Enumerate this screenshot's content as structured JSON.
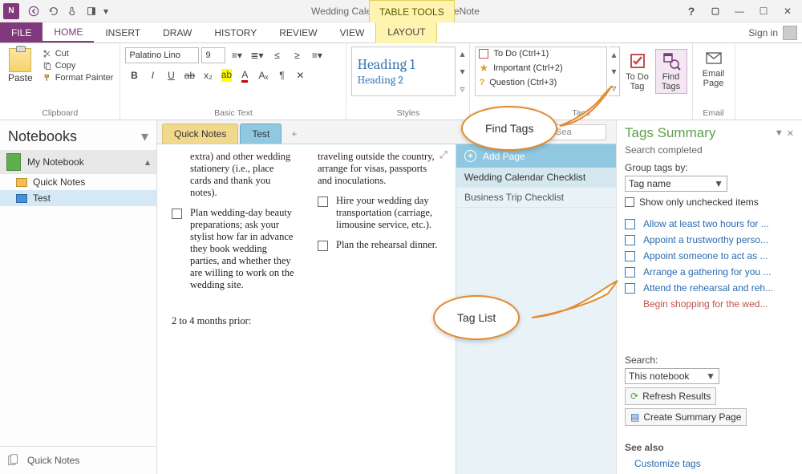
{
  "app": {
    "title": "Wedding Calendar Checklist - OneNote",
    "tabletools": "TABLE TOOLS",
    "signin": "Sign in"
  },
  "ribbon": {
    "file": "FILE",
    "tabs": [
      "HOME",
      "INSERT",
      "DRAW",
      "HISTORY",
      "REVIEW",
      "VIEW",
      "LAYOUT"
    ],
    "active_tab": "HOME",
    "clipboard": {
      "paste": "Paste",
      "cut": "Cut",
      "copy": "Copy",
      "painter": "Format Painter",
      "label": "Clipboard"
    },
    "basic_text": {
      "font": "Palatino Lino",
      "size": "9",
      "label": "Basic Text"
    },
    "styles": {
      "h1": "Heading 1",
      "h2": "Heading 2",
      "label": "Styles"
    },
    "tags": {
      "items": [
        {
          "label": "To Do (Ctrl+1)"
        },
        {
          "label": "Important (Ctrl+2)"
        },
        {
          "label": "Question (Ctrl+3)"
        }
      ],
      "todo": "To Do Tag",
      "find": "Find Tags",
      "label": "Tags"
    },
    "email": {
      "btn": "Email Page",
      "label": "Email"
    }
  },
  "notebooks": {
    "heading": "Notebooks",
    "current": "My Notebook",
    "sections": [
      "Quick Notes",
      "Test"
    ],
    "selected_section": "Test",
    "footer": "Quick Notes"
  },
  "section_tabs": {
    "tabs": [
      "Quick Notes",
      "Test"
    ],
    "active": "Test",
    "search_placeholder": "Sea"
  },
  "page": {
    "col1": [
      "extra) and other wedding stationery (i.e., place cards and thank you notes).",
      "Plan wedding-day beauty preparations; ask your stylist how far in advance they book wedding parties, and whether they are willing to work on the wedding site."
    ],
    "col2": [
      "traveling outside the country, arrange for visas, passports and inoculations.",
      "Hire your wedding day transportation (carriage, limousine service, etc.).",
      "Plan the rehearsal dinner."
    ],
    "section_head": "2 to 4 months prior:"
  },
  "page_list": {
    "add": "Add Page",
    "pages": [
      "Wedding Calendar Checklist",
      "Business Trip Checklist"
    ],
    "selected": "Wedding Calendar Checklist"
  },
  "tags_pane": {
    "title": "Tags Summary",
    "status": "Search completed",
    "group_label": "Group tags by:",
    "group_value": "Tag name",
    "show_unchecked": "Show only unchecked items",
    "results": [
      "Allow at least two hours for ...",
      "Appoint a trustworthy perso...",
      "Appoint someone to act as ...",
      "Arrange a gathering for you ...",
      "Attend the rehearsal and reh...",
      "Begin shopping for the wed..."
    ],
    "search_label": "Search:",
    "search_scope": "This notebook",
    "refresh": "Refresh Results",
    "summary_page": "Create Summary Page",
    "see_also": "See also",
    "customize": "Customize tags"
  },
  "callouts": {
    "find": "Find Tags",
    "list": "Tag List"
  },
  "colors": {
    "accent": "#80397B",
    "section_blue": "#8fc8e0",
    "callout": "#e28b2c"
  }
}
